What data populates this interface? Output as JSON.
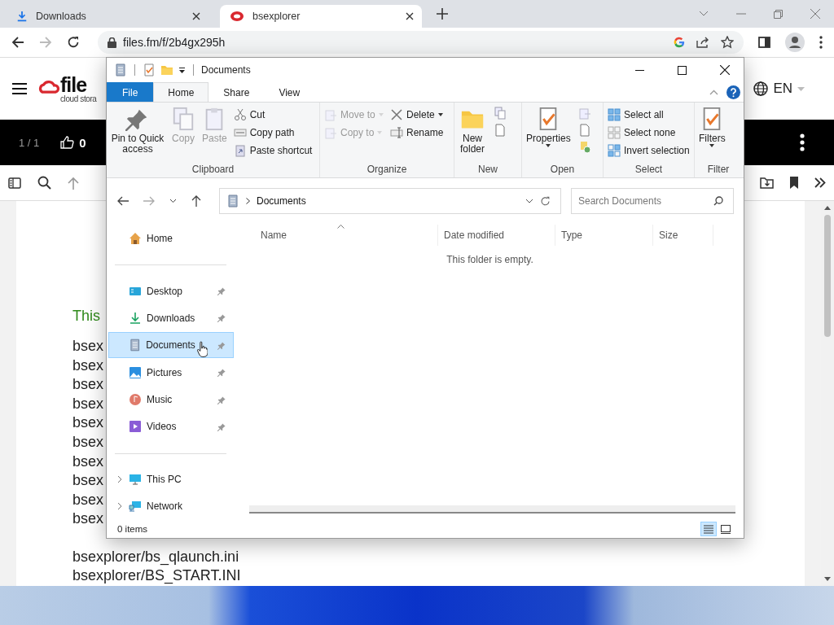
{
  "browser": {
    "tabs": [
      {
        "title": "Downloads",
        "selected": false,
        "kind": "download"
      },
      {
        "title": "bsexplorer",
        "selected": true,
        "kind": "site"
      }
    ],
    "forward_disabled": true,
    "url": "files.fm/f/2b4gx295h"
  },
  "page": {
    "logo": "file",
    "tagline": "cloud stora",
    "language": "EN",
    "counter": "1 / 1",
    "likes": "0",
    "intro": "This",
    "lines": [
      "bsex",
      "bsex",
      "bsex",
      "bsex",
      "bsex",
      "bsex",
      "bsex",
      "bsex",
      "bsex",
      "bsex"
    ],
    "more_lines": [
      "bsexplorer/bs_qlaunch.ini",
      "bsexplorer/BS_START.INI"
    ]
  },
  "explorer": {
    "title": "Documents",
    "ribbon_tabs": [
      {
        "label": "File",
        "kind": "menu",
        "selected": false
      },
      {
        "label": "Home",
        "kind": "tab",
        "selected": true
      },
      {
        "label": "Share",
        "kind": "tab",
        "selected": false
      },
      {
        "label": "View",
        "kind": "tab",
        "selected": false
      }
    ],
    "groups": [
      {
        "label": "Clipboard",
        "items": [
          {
            "label": "Pin to Quick access",
            "disabled": false
          },
          {
            "label": "Copy",
            "disabled": true
          },
          {
            "label": "Paste",
            "disabled": true
          },
          {
            "label": "Cut",
            "disabled": false
          },
          {
            "label": "Copy path",
            "disabled": false
          },
          {
            "label": "Paste shortcut",
            "disabled": false
          }
        ]
      },
      {
        "label": "Organize",
        "items": [
          {
            "label": "Move to",
            "disabled": true
          },
          {
            "label": "Copy to",
            "disabled": true
          },
          {
            "label": "Delete",
            "disabled": false
          },
          {
            "label": "Rename",
            "disabled": false
          }
        ]
      },
      {
        "label": "New",
        "items": [
          {
            "label": "New folder",
            "disabled": false
          }
        ]
      },
      {
        "label": "Open",
        "items": [
          {
            "label": "Properties",
            "disabled": false
          }
        ]
      },
      {
        "label": "Select",
        "items": [
          {
            "label": "Select all",
            "disabled": false
          },
          {
            "label": "Select none",
            "disabled": false
          },
          {
            "label": "Invert selection",
            "disabled": false
          }
        ]
      },
      {
        "label": "Filter",
        "items": [
          {
            "label": "Filters",
            "disabled": false
          }
        ]
      }
    ],
    "forward_disabled": true,
    "breadcrumb": [
      "Documents"
    ],
    "search": {
      "placeholder": "Search Documents"
    },
    "nav_sections": [
      [
        {
          "label": "Home",
          "kind": "home",
          "selected": false,
          "pinned": false
        }
      ],
      [
        {
          "label": "Desktop",
          "kind": "desktop",
          "selected": false,
          "pinned": true
        },
        {
          "label": "Downloads",
          "kind": "downloads",
          "selected": false,
          "pinned": true
        },
        {
          "label": "Documents",
          "kind": "documents",
          "selected": true,
          "pinned": true
        },
        {
          "label": "Pictures",
          "kind": "pictures",
          "selected": false,
          "pinned": true
        },
        {
          "label": "Music",
          "kind": "music",
          "selected": false,
          "pinned": true
        },
        {
          "label": "Videos",
          "kind": "videos",
          "selected": false,
          "pinned": true
        }
      ],
      [
        {
          "label": "This PC",
          "kind": "pc",
          "selected": false,
          "pinned": false,
          "expanded": false
        },
        {
          "label": "Network",
          "kind": "network",
          "selected": false,
          "pinned": false,
          "expanded": false
        }
      ]
    ],
    "columns": [
      {
        "label": "Name",
        "sorted": true
      },
      {
        "label": "Date modified",
        "sorted": false
      },
      {
        "label": "Type",
        "sorted": false
      },
      {
        "label": "Size",
        "sorted": false
      }
    ],
    "empty_message": "This folder is empty.",
    "status": "0 items",
    "views": [
      {
        "kind": "details",
        "selected": true
      },
      {
        "kind": "large",
        "selected": false
      }
    ]
  }
}
